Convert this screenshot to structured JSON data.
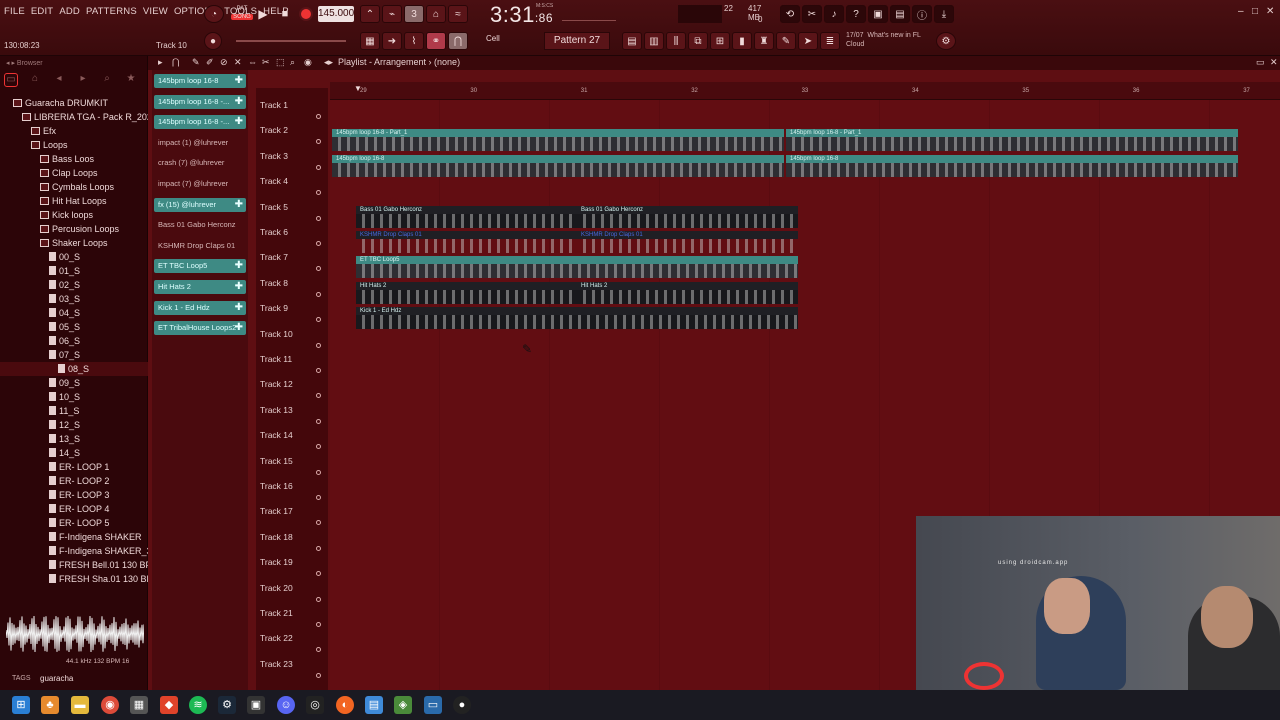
{
  "menu": [
    "FILE",
    "EDIT",
    "ADD",
    "PATTERNS",
    "VIEW",
    "OPTIONS",
    "TOOLS",
    "HELP"
  ],
  "toolbar": {
    "time_small": "130:08:23",
    "hint_track": "Track 10",
    "mode": "SONG",
    "bpm": "145.000",
    "clock": "3:31",
    "clock_frac": ":86",
    "clock_label": "M:S:CS",
    "cpu_value": "22",
    "ram_value": "417 MB",
    "ram_sub": "0",
    "snap": "Cell",
    "pattern": "Pattern 27",
    "news_date": "17/07",
    "news_title": "What's new in FL",
    "news_sub": "Cloud"
  },
  "browser": {
    "title": "Browser",
    "tree": [
      {
        "label": "Guaracha DRUMKIT",
        "type": "folder",
        "indent": 1
      },
      {
        "label": "LIBRERIA TGA - Pack R_2021",
        "type": "folder",
        "indent": 2
      },
      {
        "label": "Efx",
        "type": "folder",
        "indent": 3
      },
      {
        "label": "Loops",
        "type": "folder",
        "indent": 3
      },
      {
        "label": "Bass Loos",
        "type": "folder",
        "indent": 4
      },
      {
        "label": "Clap Loops",
        "type": "folder",
        "indent": 4
      },
      {
        "label": "Cymbals Loops",
        "type": "folder",
        "indent": 4
      },
      {
        "label": "Hit Hat Loops",
        "type": "folder",
        "indent": 4
      },
      {
        "label": "Kick loops",
        "type": "folder",
        "indent": 4
      },
      {
        "label": "Percusion Loops",
        "type": "folder",
        "indent": 4
      },
      {
        "label": "Shaker Loops",
        "type": "folder",
        "indent": 4
      },
      {
        "label": "00_S",
        "type": "file",
        "indent": 5
      },
      {
        "label": "01_S",
        "type": "file",
        "indent": 5
      },
      {
        "label": "02_S",
        "type": "file",
        "indent": 5
      },
      {
        "label": "03_S",
        "type": "file",
        "indent": 5
      },
      {
        "label": "04_S",
        "type": "file",
        "indent": 5
      },
      {
        "label": "05_S",
        "type": "file",
        "indent": 5
      },
      {
        "label": "06_S",
        "type": "file",
        "indent": 5
      },
      {
        "label": "07_S",
        "type": "file",
        "indent": 5
      },
      {
        "label": "08_S",
        "type": "file",
        "indent": 6,
        "selected": true
      },
      {
        "label": "09_S",
        "type": "file",
        "indent": 5
      },
      {
        "label": "10_S",
        "type": "file",
        "indent": 5
      },
      {
        "label": "11_S",
        "type": "file",
        "indent": 5
      },
      {
        "label": "12_S",
        "type": "file",
        "indent": 5
      },
      {
        "label": "13_S",
        "type": "file",
        "indent": 5
      },
      {
        "label": "14_S",
        "type": "file",
        "indent": 5
      },
      {
        "label": "ER- LOOP 1",
        "type": "file",
        "indent": 5
      },
      {
        "label": "ER- LOOP 2",
        "type": "file",
        "indent": 5
      },
      {
        "label": "ER- LOOP 3",
        "type": "file",
        "indent": 5
      },
      {
        "label": "ER- LOOP 4",
        "type": "file",
        "indent": 5
      },
      {
        "label": "ER- LOOP 5",
        "type": "file",
        "indent": 5
      },
      {
        "label": "F-Indigena SHAKER",
        "type": "file",
        "indent": 5
      },
      {
        "label": "F-Indigena SHAKER_3",
        "type": "file",
        "indent": 5
      },
      {
        "label": "FRESH Bell.01 130 BPM",
        "type": "file",
        "indent": 5
      },
      {
        "label": "FRESH Sha.01 130 BPM",
        "type": "file",
        "indent": 5
      }
    ],
    "preview_info": "44.1 kHz 132 BPM 16",
    "tags_label": "TAGS",
    "tags_value": "guaracha"
  },
  "playlist": {
    "title": "Playlist - Arrangement",
    "arrangement": "(none)",
    "ruler": [
      "29",
      "30",
      "31",
      "32",
      "33",
      "34",
      "35",
      "36",
      "37"
    ],
    "clips_picker": [
      {
        "label": "145bpm loop 16-8",
        "style": "teal"
      },
      {
        "label": "145bpm loop 16-8 -...",
        "style": "teal"
      },
      {
        "label": "145bpm loop 16-8 -...",
        "style": "teal"
      },
      {
        "label": "impact (1) @luhrever",
        "style": "dim"
      },
      {
        "label": "crash (7) @luhrever",
        "style": "dim"
      },
      {
        "label": "impact (7) @luhrever",
        "style": "dim"
      },
      {
        "label": "fx (15) @luhrever",
        "style": "teal"
      },
      {
        "label": "Bass 01 Gabo Herconz",
        "style": "dim"
      },
      {
        "label": "KSHMR Drop Claps 01",
        "style": "dim"
      },
      {
        "label": "ET TBC Loop5",
        "style": "teal"
      },
      {
        "label": "Hit Hats 2",
        "style": "teal"
      },
      {
        "label": "Kick 1 - Ed Hdz",
        "style": "teal"
      },
      {
        "label": "ET TribalHouse Loops2",
        "style": "teal"
      }
    ],
    "tracks": [
      "Track 1",
      "Track 2",
      "Track 3",
      "Track 4",
      "Track 5",
      "Track 6",
      "Track 7",
      "Track 8",
      "Track 9",
      "Track 10",
      "Track 11",
      "Track 12",
      "Track 13",
      "Track 14",
      "Track 15",
      "Track 16",
      "Track 17",
      "Track 18",
      "Track 19",
      "Track 20",
      "Track 21",
      "Track 22",
      "Track 23"
    ],
    "clips": [
      {
        "track": 2,
        "label": "145bpm loop 16-8 - Part_1",
        "start": 0,
        "end": 0.5,
        "style": "audio-grey"
      },
      {
        "track": 2,
        "label": "145bpm loop 16-8 - Part_1",
        "start": 0.5,
        "end": 1,
        "style": "audio-grey"
      },
      {
        "track": 3,
        "label": "145bpm loop 16-8",
        "start": 0,
        "end": 0.5,
        "style": "audio-grey"
      },
      {
        "track": 3,
        "label": "145bpm loop 16-8",
        "start": 0.5,
        "end": 1,
        "style": "audio-grey"
      },
      {
        "track": 5,
        "label": "Bass 01 Gabo Herconz",
        "start": 0,
        "end": 0.5,
        "style": "dark"
      },
      {
        "track": 5,
        "label": "Bass 01 Gabo Herconz",
        "start": 0.5,
        "end": 1,
        "style": "dark"
      },
      {
        "track": 6,
        "label": "KSHMR Drop Claps 01",
        "start": 0,
        "end": 0.5,
        "style": "kshmr"
      },
      {
        "track": 6,
        "label": "KSHMR Drop Claps 01",
        "start": 0.5,
        "end": 1,
        "style": "kshmr"
      },
      {
        "track": 7,
        "label": "ET TBC Loop5",
        "start": 0,
        "end": 1,
        "style": "audio-grey"
      },
      {
        "track": 8,
        "label": "Hit Hats 2",
        "start": 0,
        "end": 0.5,
        "style": "dark"
      },
      {
        "track": 8,
        "label": "Hit Hats 2",
        "start": 0.5,
        "end": 1,
        "style": "dark"
      },
      {
        "track": 9,
        "label": "Kick 1 - Ed Hdz",
        "start": 0,
        "end": 1,
        "style": "dark"
      }
    ]
  },
  "webcam": {
    "overlay": "using droidcam.app"
  }
}
